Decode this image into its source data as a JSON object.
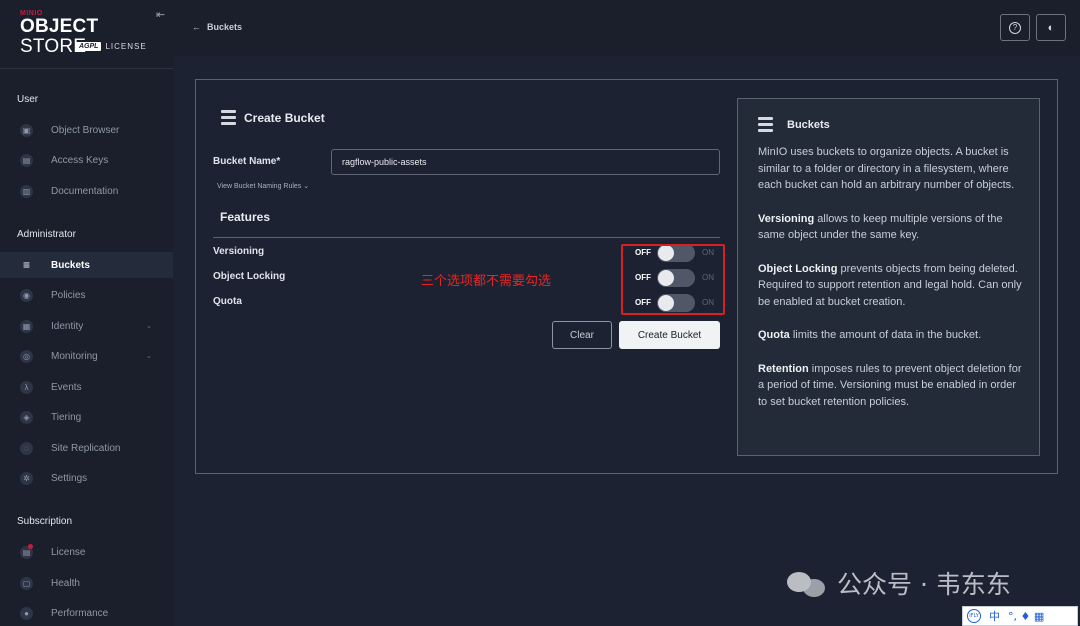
{
  "brand": {
    "minio": "MINIO",
    "title_bold": "OBJECT",
    "title_thin": " STORE",
    "agpl": "AGPL",
    "license": "LICENSE"
  },
  "sidebar": {
    "sections": [
      {
        "label": "User"
      },
      {
        "label": "Administrator"
      },
      {
        "label": "Subscription"
      }
    ],
    "user_items": [
      {
        "label": "Object Browser",
        "icon": "object-browser-icon",
        "glyph": "▣"
      },
      {
        "label": "Access Keys",
        "icon": "access-keys-icon",
        "glyph": "▤"
      },
      {
        "label": "Documentation",
        "icon": "documentation-icon",
        "glyph": "▥"
      }
    ],
    "admin_items": [
      {
        "label": "Buckets",
        "icon": "buckets-icon",
        "glyph": "≡",
        "active": true
      },
      {
        "label": "Policies",
        "icon": "policies-icon",
        "glyph": "◉"
      },
      {
        "label": "Identity",
        "icon": "identity-icon",
        "glyph": "▦",
        "chevron": "⌄"
      },
      {
        "label": "Monitoring",
        "icon": "monitoring-icon",
        "glyph": "◎",
        "chevron": "⌄"
      },
      {
        "label": "Events",
        "icon": "events-icon",
        "glyph": "λ"
      },
      {
        "label": "Tiering",
        "icon": "tiering-icon",
        "glyph": "◈"
      },
      {
        "label": "Site Replication",
        "icon": "site-replication-icon",
        "glyph": "◌"
      },
      {
        "label": "Settings",
        "icon": "settings-icon",
        "glyph": "✲"
      }
    ],
    "subscription_items": [
      {
        "label": "License",
        "icon": "license-icon",
        "glyph": "▤"
      },
      {
        "label": "Health",
        "icon": "health-icon",
        "glyph": "▢"
      },
      {
        "label": "Performance",
        "icon": "performance-icon",
        "glyph": "●"
      }
    ]
  },
  "topbar": {
    "back_arrow": "←",
    "back_label": "Buckets",
    "help_glyph": "?",
    "theme_glyph": "◐",
    "collapse_glyph": "⇤"
  },
  "form": {
    "title": "Create Bucket",
    "bucket_name_label": "Bucket Name*",
    "bucket_name_value": "ragflow-public-assets",
    "naming_rules_link": "View Bucket Naming Rules ⌄",
    "features_title": "Features",
    "toggles": [
      {
        "label": "Versioning",
        "off": "OFF",
        "on": "ON",
        "state": "off"
      },
      {
        "label": "Object Locking",
        "off": "OFF",
        "on": "ON",
        "state": "off"
      },
      {
        "label": "Quota",
        "off": "OFF",
        "on": "ON",
        "state": "off"
      }
    ],
    "annotation": "三个选项都不需要勾选",
    "clear_label": "Clear",
    "create_label": "Create Bucket"
  },
  "help": {
    "title": "Buckets",
    "p1": "MinIO uses buckets to organize objects. A bucket is similar to a folder or directory in a filesystem, where each bucket can hold an arbitrary number of objects.",
    "p2_bold": "Versioning",
    "p2": " allows to keep multiple versions of the same object under the same key.",
    "p3_bold": "Object Locking",
    "p3": " prevents objects from being deleted. Required to support retention and legal hold. Can only be enabled at bucket creation.",
    "p4_bold": "Quota",
    "p4": " limits the amount of data in the bucket.",
    "p5_bold": "Retention",
    "p5": " imposes rules to prevent object deletion for a period of time. Versioning must be enabled in order to set bucket retention policies."
  },
  "watermark": {
    "text": "公众号 · 韦东东"
  },
  "ime": {
    "lang": "中",
    "glyphs": "°, ♦ ▦"
  },
  "colors": {
    "background": "#1c2231",
    "sidebar": "#1a1f2b",
    "annotation_red": "#e52727",
    "accent_badge": "#c51c3f"
  }
}
